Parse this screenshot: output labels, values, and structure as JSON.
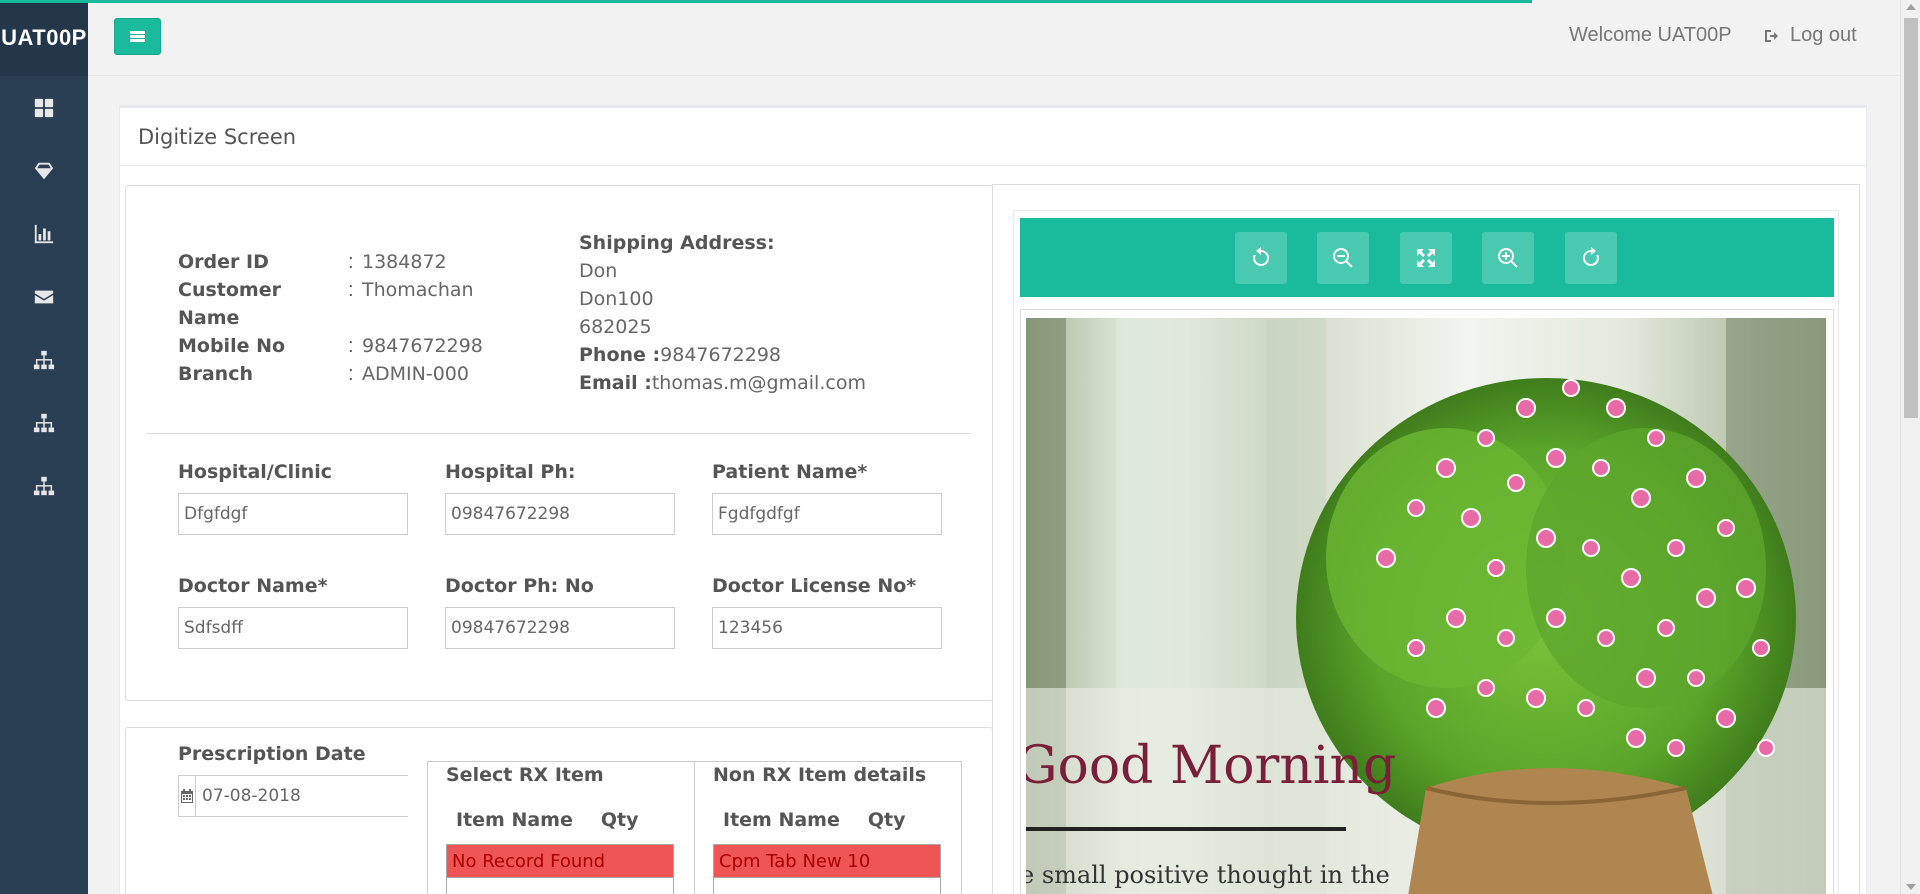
{
  "sidebar": {
    "brand": "UAT00P",
    "icons": [
      "dashboard-icon",
      "diamond-icon",
      "bar-chart-icon",
      "envelope-icon",
      "sitemap-icon",
      "sitemap-icon",
      "sitemap-icon"
    ]
  },
  "topnav": {
    "welcome": "Welcome UAT00P",
    "logout": "Log out"
  },
  "panel": {
    "title": "Digitize Screen"
  },
  "order": {
    "labels": {
      "order_id": "Order ID",
      "customer_name": "Customer Name",
      "mobile_no": "Mobile No",
      "branch": "Branch"
    },
    "separator": ":",
    "values": {
      "order_id": "1384872",
      "customer_name": "Thomachan",
      "mobile_no": "9847672298",
      "branch": "ADMIN-000"
    }
  },
  "shipping": {
    "heading": "Shipping Address:",
    "line1": "Don",
    "line2": "Don100",
    "line3": "682025",
    "phone_label": "Phone :",
    "phone": "9847672298",
    "email_label": "Email :",
    "email": "thomas.m@gmail.com"
  },
  "form": {
    "hospital_clinic": {
      "label": "Hospital/Clinic",
      "value": "Dfgfdgf"
    },
    "hospital_ph": {
      "label": "Hospital Ph:",
      "value": "09847672298"
    },
    "patient_name": {
      "label": "Patient Name*",
      "value": "Fgdfgdfgf"
    },
    "doctor_name": {
      "label": "Doctor Name*",
      "value": "Sdfsdff"
    },
    "doctor_ph": {
      "label": "Doctor Ph: No",
      "value": "09847672298"
    },
    "doctor_license": {
      "label": "Doctor License No*",
      "value": "123456"
    }
  },
  "prescription": {
    "date_label": "Prescription Date",
    "date_value": "07-08-2018",
    "rx": {
      "title": "Select RX Item",
      "col_item": "Item Name",
      "col_qty": "Qty",
      "rows": [
        "No Record Found"
      ]
    },
    "non_rx": {
      "title": "Non RX Item details",
      "col_item": "Item Name",
      "col_qty": "Qty",
      "rows": [
        "Cpm Tab New 10"
      ]
    }
  },
  "viewer": {
    "tools": [
      "rotate-left-icon",
      "zoom-out-icon",
      "fullscreen-icon",
      "zoom-in-icon",
      "rotate-right-icon"
    ],
    "image_text": {
      "headline": "Good Morning",
      "subline": "e small positive thought in the"
    }
  },
  "colors": {
    "accent": "#1abb9c",
    "sidebar": "#2a3f54",
    "error_row": "#f05555"
  }
}
